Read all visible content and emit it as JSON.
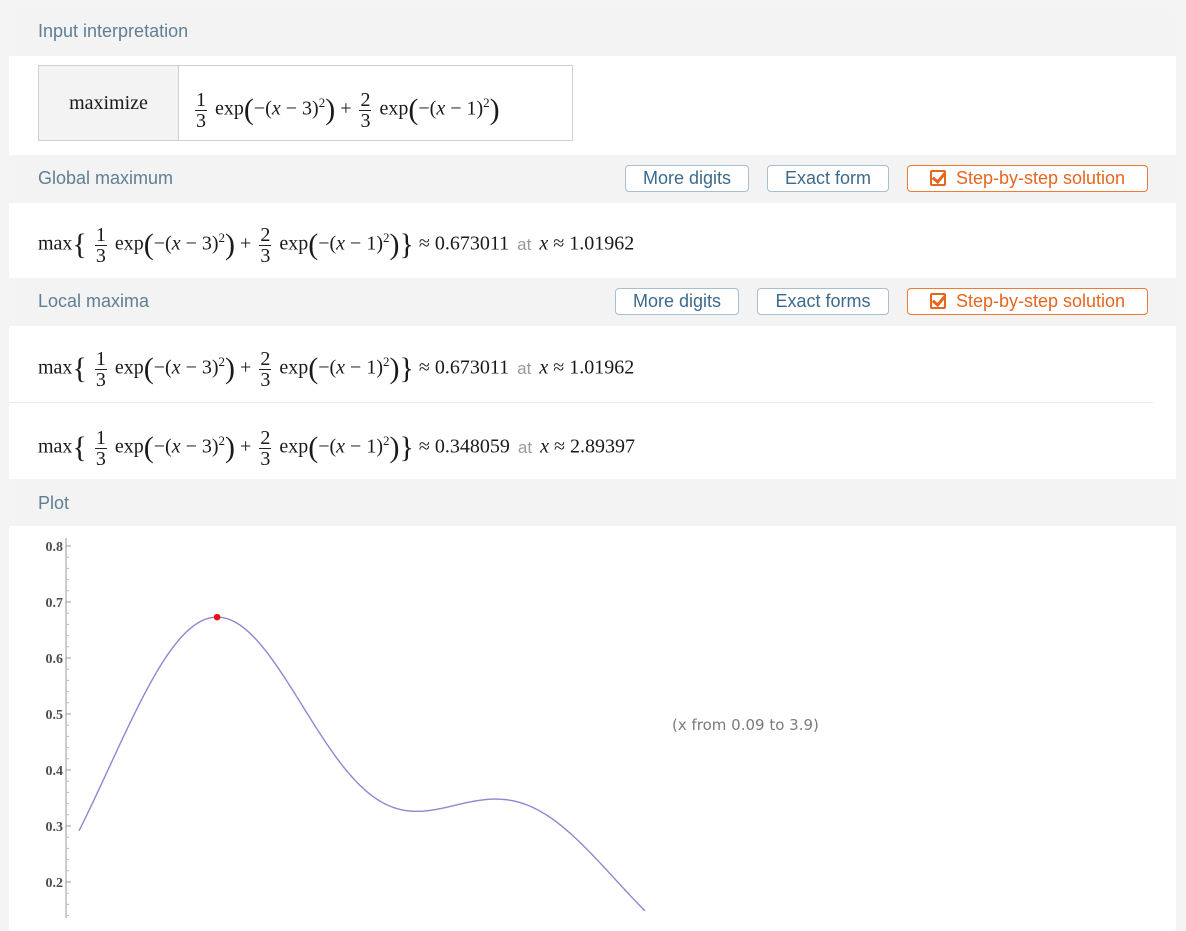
{
  "pods": {
    "input": {
      "title": "Input interpretation",
      "label": "maximize"
    },
    "global": {
      "title": "Global maximum",
      "buttons": {
        "more_digits": "More digits",
        "exact": "Exact form",
        "step": "Step-by-step solution"
      },
      "value": "0.673011",
      "at": "at",
      "x_value": "1.01962"
    },
    "local": {
      "title": "Local maxima",
      "buttons": {
        "more_digits": "More digits",
        "exact": "Exact forms",
        "step": "Step-by-step solution"
      },
      "rows": [
        {
          "value": "0.673011",
          "at": "at",
          "x_value": "1.01962"
        },
        {
          "value": "0.348059",
          "at": "at",
          "x_value": "2.89397"
        }
      ]
    },
    "plot": {
      "title": "Plot",
      "range_note": "(x from 0.09 to 3.9)"
    }
  },
  "formula": {
    "max": "max",
    "n1": "1",
    "d1": "3",
    "n2": "2",
    "d2": "3",
    "exp": "exp",
    "minus": "−",
    "shift1": "3",
    "shift2": "1",
    "pow": "2",
    "plus": "+",
    "approx": "≈",
    "var": "x"
  },
  "colors": {
    "pod_title": "#5f7f94",
    "button_border": "#a9bfcf",
    "step_accent": "#e6661e",
    "curve": "#8a8ad0",
    "max_point": "#ee1111"
  },
  "chart_data": {
    "type": "line",
    "function": "(1/3)exp(-(x-3)^2) + (2/3)exp(-(x-1)^2)",
    "x_range": [
      0.09,
      3.9
    ],
    "ylim": [
      0.15,
      0.8
    ],
    "y_ticks": [
      "0.8",
      "0.7",
      "0.6",
      "0.5",
      "0.4",
      "0.3",
      "0.2"
    ],
    "y_tick_values": [
      0.8,
      0.7,
      0.6,
      0.5,
      0.4,
      0.3,
      0.2
    ],
    "highlight_point": {
      "x": 1.01962,
      "y": 0.673011
    },
    "grid": false
  }
}
